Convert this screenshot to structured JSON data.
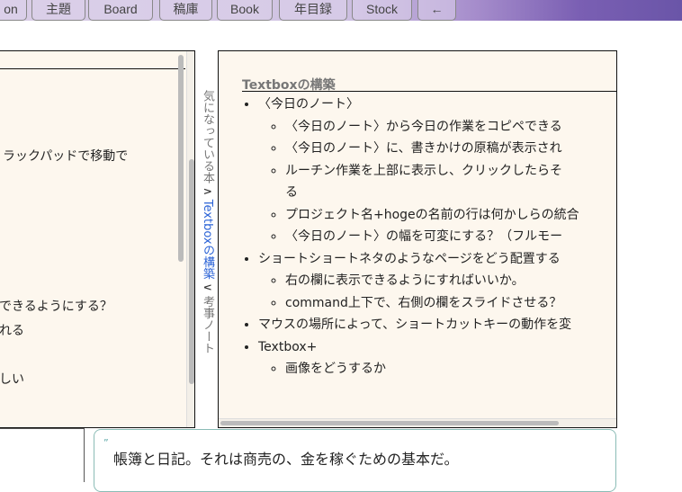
{
  "tabs": [
    {
      "label": "on"
    },
    {
      "label": "主題"
    },
    {
      "label": "Board"
    },
    {
      "label": "稿庫"
    },
    {
      "label": "Book"
    },
    {
      "label": "年目録"
    },
    {
      "label": "Stock"
    },
    {
      "label": "←"
    }
  ],
  "left_panel": {
    "lines": [
      "ラックパッドで移動で",
      "できるようにする？",
      "れる",
      "しい"
    ]
  },
  "vertical_nav": {
    "prev": "気になっている本",
    "up_arrow": "∧",
    "current": "Textboxの構築",
    "down_arrow": "∨",
    "next": "考事ノート"
  },
  "right_panel": {
    "title": "Textboxの構築",
    "items": [
      {
        "text": "〈今日のノート〉",
        "children": [
          "〈今日のノート〉から今日の作業をコピペできる",
          "〈今日のノート〉に、書きかけの原稿が表示され",
          "ルーチン作業を上部に表示し、クリックしたらそ る",
          "プロジェクト名+hogeの名前の行は何かしらの統合",
          "〈今日のノート〉の幅を可変にする？（フルモー"
        ]
      },
      {
        "text": "ショートショートネタのようなページをどう配置する",
        "children": [
          "右の欄に表示できるようにすればいいか。",
          "command上下で、右側の欄をスライドさせる？"
        ]
      },
      {
        "text": "マウスの場所によって、ショートカットキーの動作を変",
        "children": []
      },
      {
        "text": "Textbox+",
        "children": [
          "画像をどうするか"
        ]
      }
    ]
  },
  "quote": {
    "mark": "”",
    "text": "帳簿と日記。それは商売の、金を稼ぐための基本だ。"
  }
}
